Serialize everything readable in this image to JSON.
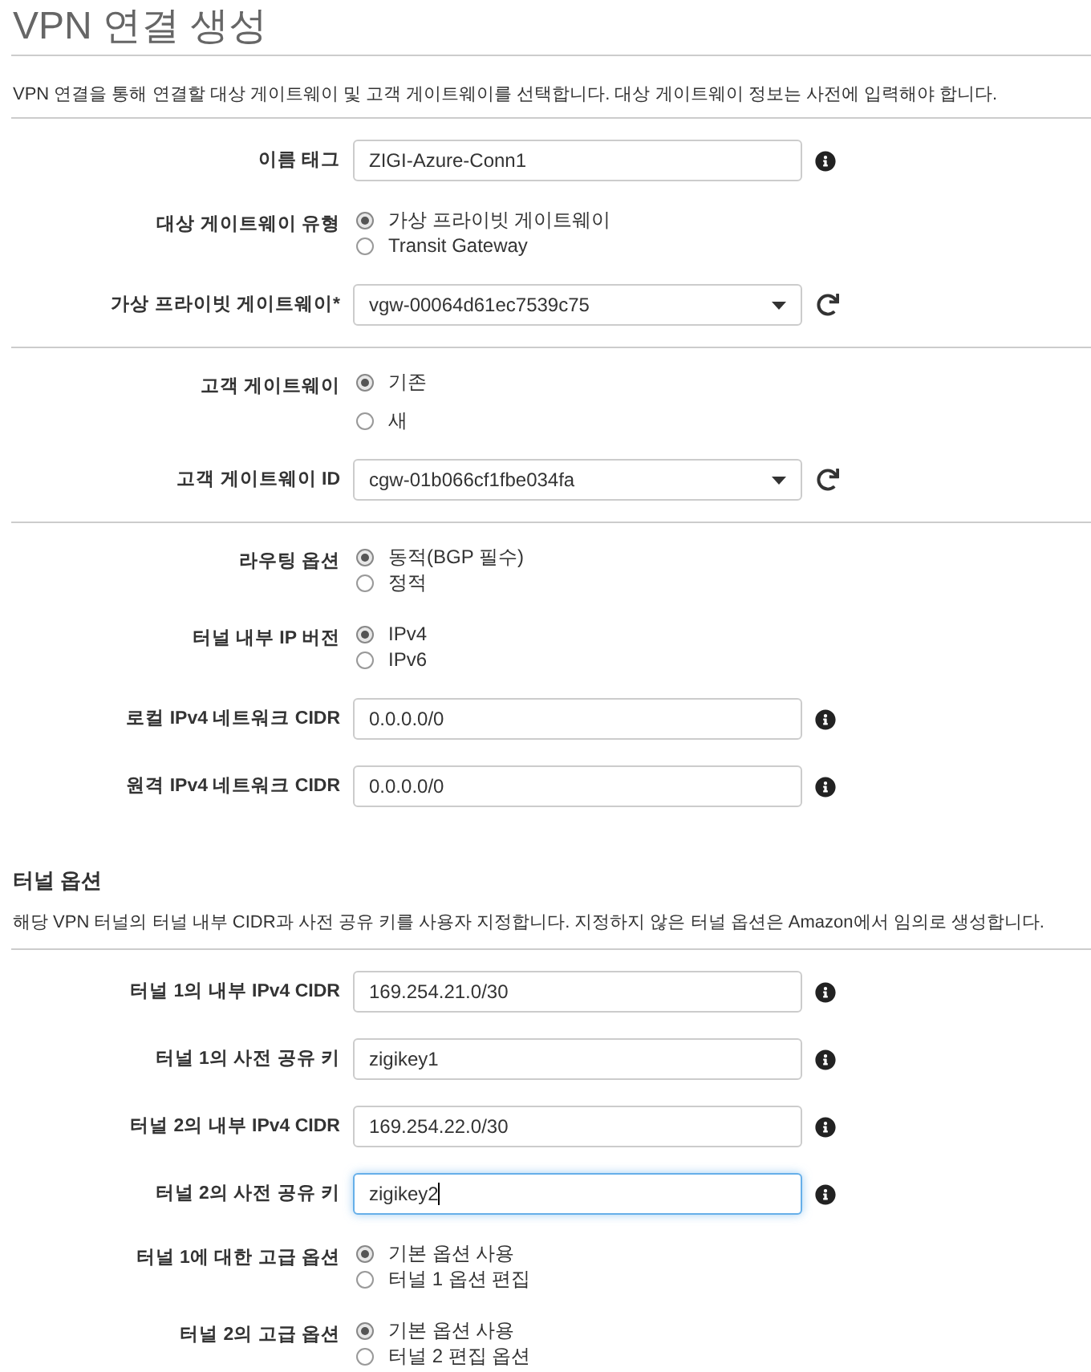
{
  "title": "VPN 연결 생성",
  "description": "VPN 연결을 통해 연결할 대상 게이트웨이 및 고객 게이트웨이를 선택합니다. 대상 게이트웨이 정보는 사전에 입력해야 합니다.",
  "sections": [
    {
      "fields": [
        {
          "kind": "text",
          "label": "이름 태그",
          "value": "ZIGI-Azure-Conn1",
          "focused": false
        },
        {
          "kind": "radio",
          "label": "대상 게이트웨이 유형",
          "options": [
            {
              "label": "가상 프라이빗 게이트웨이",
              "selected": true
            },
            {
              "label": "Transit Gateway",
              "selected": false
            }
          ]
        },
        {
          "kind": "select",
          "label": "가상 프라이빗 게이트웨이*",
          "value": "vgw-00064d61ec7539c75"
        }
      ]
    },
    {
      "fields": [
        {
          "kind": "radio",
          "label": "고객 게이트웨이",
          "options": [
            {
              "label": "기존",
              "selected": true
            },
            {
              "label": "새",
              "selected": false
            }
          ]
        },
        {
          "kind": "select",
          "label": "고객 게이트웨이 ID",
          "value": "cgw-01b066cf1fbe034fa"
        }
      ]
    },
    {
      "fields": [
        {
          "kind": "radio",
          "label": "라우팅 옵션",
          "options": [
            {
              "label": "동적(BGP 필수)",
              "selected": true
            },
            {
              "label": "정적",
              "selected": false
            }
          ]
        },
        {
          "kind": "radio",
          "label": "터널 내부 IP 버전",
          "options": [
            {
              "label": "IPv4",
              "selected": true
            },
            {
              "label": "IPv6",
              "selected": false
            }
          ]
        },
        {
          "kind": "text",
          "label": "로컬 IPv4 네트워크 CIDR",
          "value": "0.0.0.0/0",
          "focused": false
        },
        {
          "kind": "text",
          "label": "원격 IPv4 네트워크 CIDR",
          "value": "0.0.0.0/0",
          "focused": false
        }
      ]
    }
  ],
  "tunnel_options": {
    "heading": "터널 옵션",
    "description": "해당 VPN 터널의 터널 내부 CIDR과 사전 공유 키를 사용자 지정합니다. 지정하지 않은 터널 옵션은 Amazon에서 임의로 생성합니다.",
    "fields": [
      {
        "kind": "text",
        "label": "터널 1의 내부 IPv4 CIDR",
        "value": "169.254.21.0/30",
        "focused": false
      },
      {
        "kind": "text",
        "label": "터널 1의 사전 공유 키",
        "value": "zigikey1",
        "focused": false
      },
      {
        "kind": "text",
        "label": "터널 2의 내부 IPv4 CIDR",
        "value": "169.254.22.0/30",
        "focused": false
      },
      {
        "kind": "text",
        "label": "터널 2의 사전 공유 키",
        "value": "zigikey2",
        "focused": true
      },
      {
        "kind": "radio",
        "label": "터널 1에 대한 고급 옵션",
        "options": [
          {
            "label": "기본 옵션 사용",
            "selected": true
          },
          {
            "label": "터널 1 옵션 편집",
            "selected": false
          }
        ]
      },
      {
        "kind": "radio",
        "label": "터널 2의 고급 옵션",
        "options": [
          {
            "label": "기본 옵션 사용",
            "selected": true
          },
          {
            "label": "터널 2 편집 옵션",
            "selected": false
          }
        ]
      }
    ]
  }
}
